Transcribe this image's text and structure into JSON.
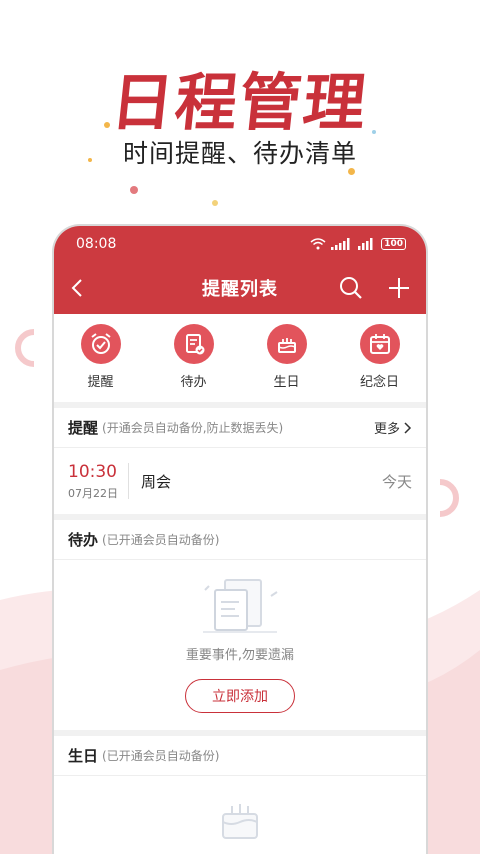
{
  "promo": {
    "title": "日程管理",
    "subtitle": "时间提醒、待办清单"
  },
  "status_bar": {
    "time": "08:08",
    "battery": "100"
  },
  "nav": {
    "title": "提醒列表"
  },
  "quick_actions": [
    {
      "label": "提醒",
      "icon": "alarm-clock-icon"
    },
    {
      "label": "待办",
      "icon": "todo-list-icon"
    },
    {
      "label": "生日",
      "icon": "birthday-cake-icon"
    },
    {
      "label": "纪念日",
      "icon": "calendar-heart-icon"
    }
  ],
  "reminders": {
    "title": "提醒",
    "note": "(开通会员自动备份,防止数据丢失)",
    "more": "更多",
    "items": [
      {
        "time": "10:30",
        "date": "07月22日",
        "title": "周会",
        "day": "今天"
      }
    ]
  },
  "todos": {
    "title": "待办",
    "note": "(已开通会员自动备份)",
    "empty_text": "重要事件,勿要遗漏",
    "add_label": "立即添加"
  },
  "birthdays": {
    "title": "生日",
    "note": "(已开通会员自动备份)"
  },
  "colors": {
    "accent": "#cc3a40",
    "icon_bg": "#e2545c",
    "text_muted": "#888888"
  }
}
